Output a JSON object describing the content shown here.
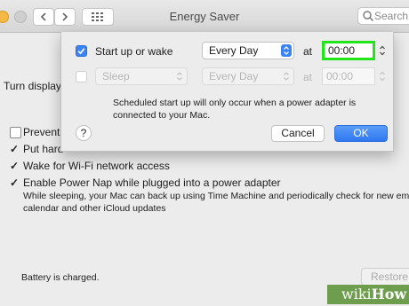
{
  "window": {
    "title": "Energy Saver",
    "search_placeholder": "Search"
  },
  "background": {
    "turn_display": "Turn display",
    "prevent": "Prevent",
    "put_hard": "Put hard",
    "wake_wifi": "Wake for Wi-Fi network access",
    "power_nap": "Enable Power Nap while plugged into a power adapter",
    "power_nap_desc_1": "While sleeping, your Mac can back up using Time Machine and periodically check for new email,",
    "power_nap_desc_2": "calendar and other iCloud updates",
    "battery_status": "Battery is charged.",
    "restore_label": "Restore",
    "checkmark": "✓"
  },
  "sheet": {
    "startup": {
      "label": "Start up or wake",
      "checked": true,
      "frequency": "Every Day",
      "at_label": "at",
      "time": "00:00"
    },
    "sleep": {
      "label": "Sleep",
      "checked": false,
      "frequency": "Every Day",
      "at_label": "at",
      "time": "00:00"
    },
    "note_line1": "Scheduled start up will only occur when a power adapter is",
    "note_line2": "connected to your Mac.",
    "help_label": "?",
    "cancel_label": "Cancel",
    "ok_label": "OK"
  },
  "watermark": {
    "wiki": "wiki",
    "how": "How"
  },
  "colors": {
    "accent": "#3b82f6",
    "highlight": "#22e51c",
    "watermark_bg": "#6e9e4d"
  }
}
